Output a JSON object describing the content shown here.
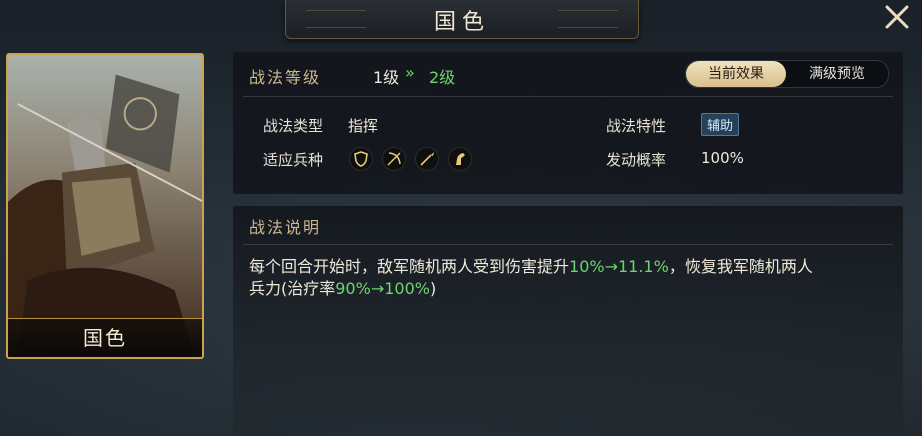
{
  "title": "国色",
  "card": {
    "name": "国色"
  },
  "level": {
    "label": "战法等级",
    "current": "1级",
    "arrow": "»",
    "next": "2级"
  },
  "tabs": {
    "current": "当前效果",
    "max": "满级预览"
  },
  "info": {
    "type_label": "战法类型",
    "type_value": "指挥",
    "trait_label": "战法特性",
    "trait_value": "辅助",
    "troops_label": "适应兵种",
    "troops": [
      "shield-icon",
      "bow-icon",
      "spear-icon",
      "horse-icon"
    ],
    "rate_label": "发动概率",
    "rate_value": "100%"
  },
  "description": {
    "title": "战法说明",
    "line1_a": "每个回合开始时，敌军随机两人受到伤害提升",
    "line1_b": "10%→11.1%",
    "line1_c": "，恢复我军随机两人",
    "line2_a": "兵力(治疗率",
    "line2_b": "90%→100%",
    "line2_c": ")"
  },
  "colors": {
    "accent_gold": "#cdb88f",
    "upgrade_green": "#6fd36f",
    "tab_active": "#e8d3a3"
  }
}
